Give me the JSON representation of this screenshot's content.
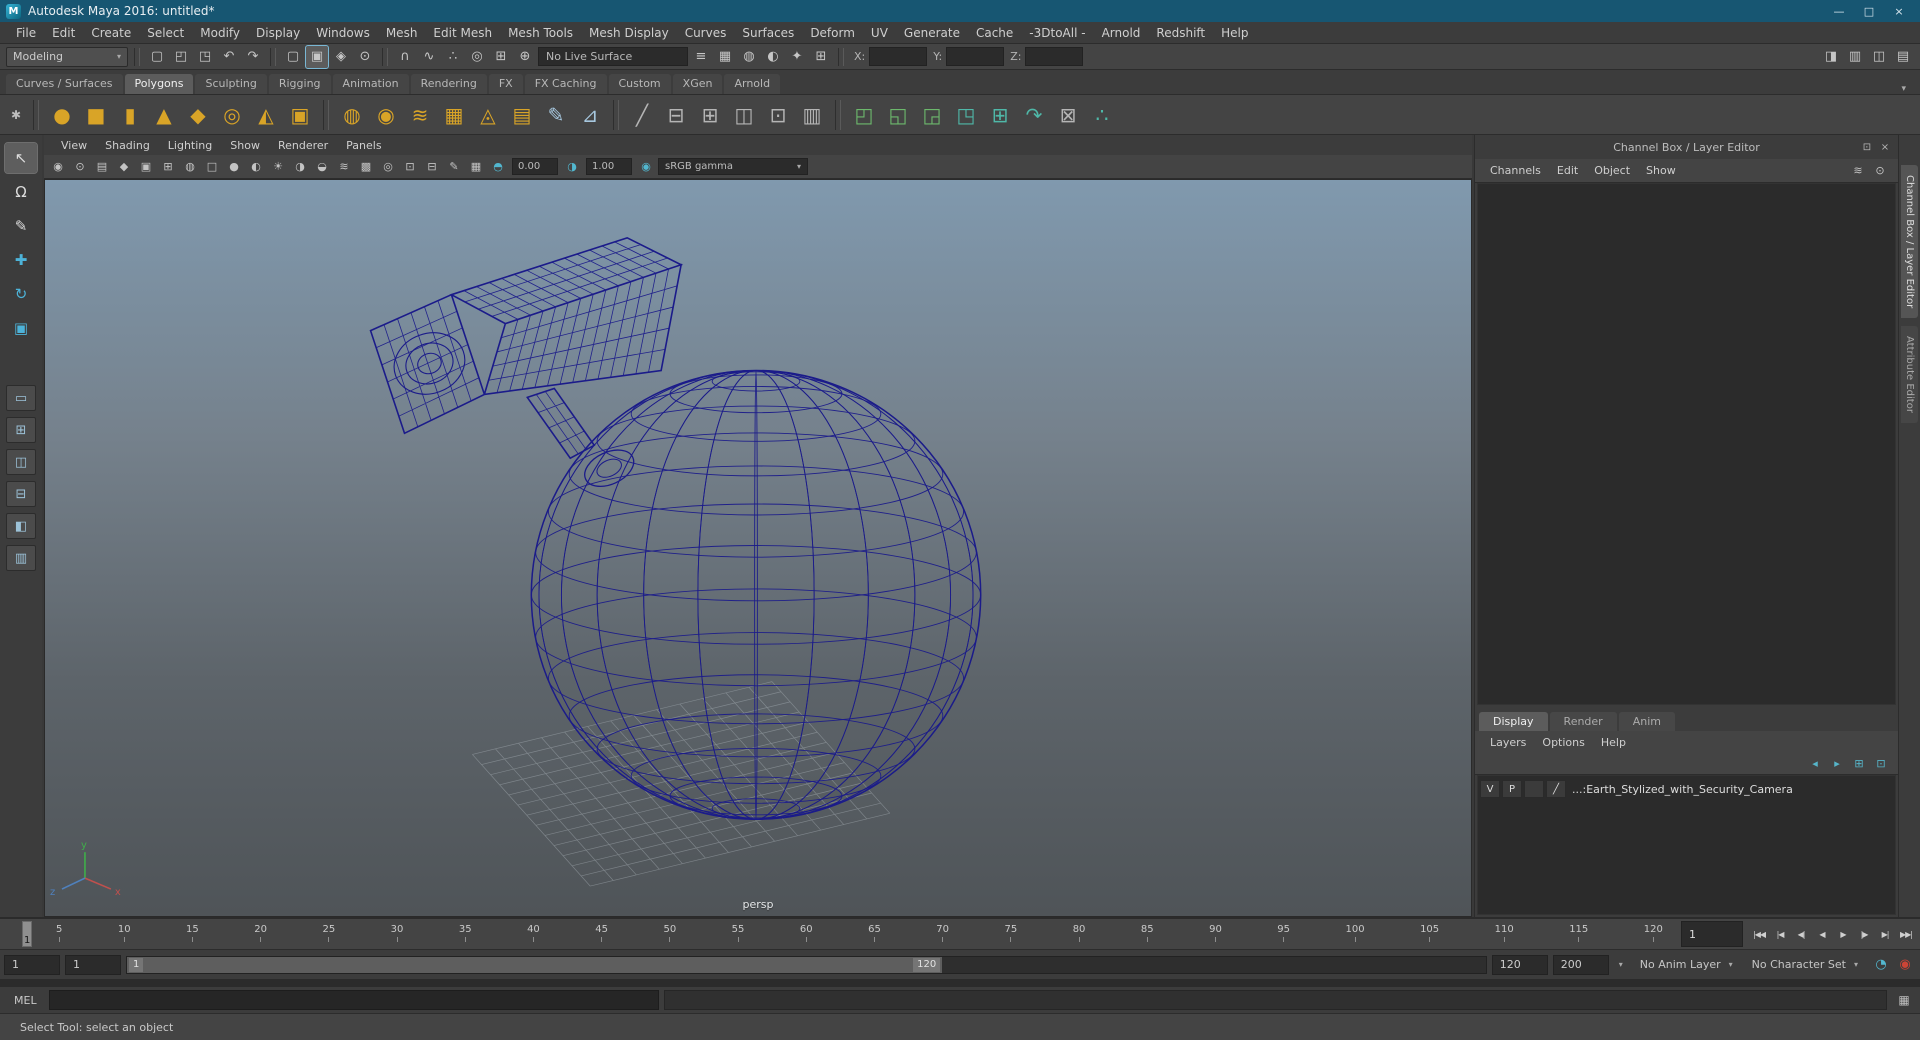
{
  "titlebar": {
    "logo": "M",
    "title": "Autodesk Maya 2016: untitled*",
    "minimize": "—",
    "maximize": "□",
    "close": "×"
  },
  "menubar": {
    "items": [
      "File",
      "Edit",
      "Create",
      "Select",
      "Modify",
      "Display",
      "Windows",
      "Mesh",
      "Edit Mesh",
      "Mesh Tools",
      "Mesh Display",
      "Curves",
      "Surfaces",
      "Deform",
      "UV",
      "Generate",
      "Cache",
      "-3DtoAll -",
      "Arnold",
      "Redshift",
      "Help"
    ]
  },
  "statusline": {
    "mode": {
      "label": "Modeling",
      "caret": "▾"
    },
    "file_icons": [
      {
        "n": "new-scene-icon",
        "g": "▢"
      },
      {
        "n": "open-scene-icon",
        "g": "◰"
      },
      {
        "n": "save-scene-icon",
        "g": "◳"
      }
    ],
    "history_icons": [
      {
        "n": "undo-icon",
        "g": "↶"
      },
      {
        "n": "redo-icon",
        "g": "↷"
      }
    ],
    "selection_icons": [
      {
        "n": "select-hierarchy-icon",
        "g": "▢"
      },
      {
        "n": "select-object-icon",
        "g": "▣",
        "active": true
      },
      {
        "n": "select-component-icon",
        "g": "◈"
      },
      {
        "n": "select-mask-icon",
        "g": "⊙"
      }
    ],
    "snap_icons": [
      {
        "n": "snap-to-grid-icon",
        "g": "∩"
      },
      {
        "n": "snap-to-curve-icon",
        "g": "∿"
      },
      {
        "n": "snap-to-point-icon",
        "g": "∴"
      },
      {
        "n": "snap-projected-center-icon",
        "g": "◎"
      },
      {
        "n": "snap-view-plane-icon",
        "g": "⊞"
      },
      {
        "n": "make-live-icon",
        "g": "⊕"
      }
    ],
    "live_surface": "No Live Surface",
    "render_icons": [
      {
        "n": "construction-history-icon",
        "g": "≡"
      },
      {
        "n": "open-render-view-icon",
        "g": "▦"
      },
      {
        "n": "render-current-frame-icon",
        "g": "◍"
      },
      {
        "n": "ipr-render-icon",
        "g": "◐"
      },
      {
        "n": "render-settings-icon",
        "g": "✦"
      },
      {
        "n": "input-mode-icon",
        "g": "⊞"
      }
    ],
    "coords": {
      "x_label": "X:",
      "y_label": "Y:",
      "z_label": "Z:"
    },
    "right_icons": [
      {
        "n": "toggle-modeling-toolkit-icon",
        "g": "◨"
      },
      {
        "n": "toggle-attribute-editor-icon",
        "g": "▥"
      },
      {
        "n": "toggle-tool-settings-icon",
        "g": "◫"
      },
      {
        "n": "toggle-channel-box-icon",
        "g": "▤"
      }
    ]
  },
  "shelf": {
    "options_icon": "✱",
    "menu_caret": "▾",
    "tabs": [
      {
        "label": "Curves / Surfaces"
      },
      {
        "label": "Polygons",
        "active": true
      },
      {
        "label": "Sculpting"
      },
      {
        "label": "Rigging"
      },
      {
        "label": "Animation"
      },
      {
        "label": "Rendering"
      },
      {
        "label": "FX"
      },
      {
        "label": "FX Caching"
      },
      {
        "label": "Custom"
      },
      {
        "label": "XGen"
      },
      {
        "label": "Arnold"
      }
    ],
    "icons_primitives": [
      {
        "n": "poly-sphere-icon",
        "g": "●",
        "c": "gold"
      },
      {
        "n": "poly-cube-icon",
        "g": "■",
        "c": "gold"
      },
      {
        "n": "poly-cylinder-icon",
        "g": "▮",
        "c": "gold"
      },
      {
        "n": "poly-cone-icon",
        "g": "▲",
        "c": "gold"
      },
      {
        "n": "poly-plane-icon",
        "g": "◆",
        "c": "gold"
      },
      {
        "n": "poly-torus-icon",
        "g": "◎",
        "c": "gold"
      },
      {
        "n": "poly-prism-icon",
        "g": "◭",
        "c": "gold"
      },
      {
        "n": "poly-pipe-icon",
        "g": "▣",
        "c": "gold"
      }
    ],
    "icons_shapes": [
      {
        "n": "smooth-mesh-icon",
        "g": "◍",
        "c": "gold"
      },
      {
        "n": "uv-sphere-icon",
        "g": "◉",
        "c": "gold"
      },
      {
        "n": "poly-disc-icon",
        "g": "≋",
        "c": "gold"
      },
      {
        "n": "poly-grid-icon",
        "g": "▦",
        "c": "gold"
      },
      {
        "n": "platonic-solid-icon",
        "g": "◬",
        "c": "gold"
      },
      {
        "n": "super-shape-icon",
        "g": "▤",
        "c": "gold"
      },
      {
        "n": "pencil-curve-icon",
        "g": "✎",
        "c": "blue"
      },
      {
        "n": "quad-draw-icon",
        "g": "⊿",
        "c": "blue"
      }
    ],
    "icons_edit": [
      {
        "n": "multi-cut-icon",
        "g": "╱",
        "c": "gray"
      },
      {
        "n": "insert-edge-loop-icon",
        "g": "⊟",
        "c": "gray"
      },
      {
        "n": "offset-edge-loop-icon",
        "g": "⊞",
        "c": "gray"
      },
      {
        "n": "crease-tool-icon",
        "g": "◫",
        "c": "gray"
      },
      {
        "n": "target-weld-icon",
        "g": "⊡",
        "c": "gray"
      },
      {
        "n": "connect-tool-icon",
        "g": "▥",
        "c": "gray"
      }
    ],
    "icons_boolean": [
      {
        "n": "combine-icon",
        "g": "◰",
        "c": "green"
      },
      {
        "n": "separate-icon",
        "g": "◱",
        "c": "green"
      },
      {
        "n": "boolean-union-icon",
        "g": "◲",
        "c": "green"
      },
      {
        "n": "extract-icon",
        "g": "◳",
        "c": "teal"
      },
      {
        "n": "duplicate-face-icon",
        "g": "⊞",
        "c": "teal"
      },
      {
        "n": "mirror-geometry-icon",
        "g": "↷",
        "c": "teal"
      },
      {
        "n": "uv-checker-icon",
        "g": "⊠",
        "c": "gray"
      },
      {
        "n": "transfer-attributes-icon",
        "g": "∴",
        "c": "teal"
      }
    ]
  },
  "toolbox": {
    "tools": [
      {
        "n": "select-tool-icon",
        "g": "↖",
        "active": true
      },
      {
        "n": "lasso-tool-icon",
        "g": "Ω"
      },
      {
        "n": "paint-select-tool-icon",
        "g": "✎"
      },
      {
        "n": "move-tool-icon",
        "g": "✚",
        "c": "teal"
      },
      {
        "n": "rotate-tool-icon",
        "g": "↻",
        "c": "teal"
      },
      {
        "n": "scale-tool-icon",
        "g": "▣",
        "c": "teal"
      }
    ],
    "layouts": [
      {
        "n": "layout-single-pane-icon",
        "g": "▭"
      },
      {
        "n": "layout-four-pane-icon",
        "g": "⊞"
      },
      {
        "n": "layout-two-side-by-side-icon",
        "g": "◫"
      },
      {
        "n": "layout-two-stacked-icon",
        "g": "⊟"
      },
      {
        "n": "layout-three-split-icon",
        "g": "◧"
      },
      {
        "n": "layout-outliner-persp-icon",
        "g": "▥"
      }
    ]
  },
  "viewport": {
    "menus": [
      "View",
      "Shading",
      "Lighting",
      "Show",
      "Renderer",
      "Panels"
    ],
    "toolbar_icons": [
      {
        "n": "select-camera-icon",
        "g": "◉"
      },
      {
        "n": "lock-camera-icon",
        "g": "⊙"
      },
      {
        "n": "camera-attributes-icon",
        "g": "▤"
      },
      {
        "n": "bookmarks-icon",
        "g": "◆"
      },
      {
        "n": "image-plane-icon",
        "g": "▣"
      },
      {
        "n": "pan-zoom-2d-icon",
        "g": "⊞"
      },
      {
        "n": "oversampling-icon",
        "g": "◍"
      },
      {
        "n": "wireframe-mode-icon",
        "g": "□"
      },
      {
        "n": "shaded-mode-icon",
        "g": "●"
      },
      {
        "n": "textured-mode-icon",
        "g": "◐"
      },
      {
        "n": "use-all-lights-icon",
        "g": "☀"
      },
      {
        "n": "shadows-icon",
        "g": "◑"
      },
      {
        "n": "ambient-occlusion-icon",
        "g": "◒"
      },
      {
        "n": "motion-blur-icon",
        "g": "≋"
      },
      {
        "n": "multisample-icon",
        "g": "▩"
      },
      {
        "n": "xray-icon",
        "g": "◎"
      },
      {
        "n": "isolate-select-icon",
        "g": "⊡"
      },
      {
        "n": "field-chart-icon",
        "g": "⊟"
      },
      {
        "n": "grease-pencil-icon",
        "g": "✎"
      },
      {
        "n": "grid-toggle-icon",
        "g": "▦"
      }
    ],
    "exposure_icon": {
      "n": "exposure-icon",
      "g": "◓"
    },
    "exposure": "0.00",
    "contrast_icon": {
      "n": "contrast-icon",
      "g": "◑"
    },
    "gamma": "1.00",
    "colorspace_icon": {
      "n": "color-management-icon",
      "g": "◉"
    },
    "colorspace": "sRGB gamma",
    "caret": "▾",
    "camera_label": "persp",
    "axis": {
      "x": "x",
      "y": "y",
      "z": "z"
    }
  },
  "channelbox": {
    "header": "Channel Box / Layer Editor",
    "header_icons": [
      {
        "n": "panel-dock-icon",
        "g": "⊡"
      },
      {
        "n": "panel-close-icon",
        "g": "×"
      }
    ],
    "menus": [
      "Channels",
      "Edit",
      "Object",
      "Show"
    ],
    "menu_icons": [
      {
        "n": "channel-slider-mode-icon",
        "g": "≋"
      },
      {
        "n": "channel-manipulator-icon",
        "g": "⊙"
      }
    ],
    "layer_tabs": [
      {
        "label": "Display",
        "active": true
      },
      {
        "label": "Render"
      },
      {
        "label": "Anim"
      }
    ],
    "layer_menus": [
      "Layers",
      "Options",
      "Help"
    ],
    "layer_toolbar_icons": [
      {
        "n": "layer-move-up-icon",
        "g": "◂"
      },
      {
        "n": "layer-move-down-icon",
        "g": "▸"
      },
      {
        "n": "add-empty-layer-icon",
        "g": "⊞"
      },
      {
        "n": "add-layer-from-selection-icon",
        "g": "⊡"
      }
    ],
    "layers": [
      {
        "visible": "V",
        "playback": "P",
        "swatch": "╱",
        "name": "...:Earth_Stylized_with_Security_Camera"
      }
    ],
    "side_tabs": [
      {
        "label": "Channel Box / Layer Editor",
        "active": true
      },
      {
        "label": "Attribute Editor"
      }
    ]
  },
  "timeline": {
    "current_frame": "1",
    "ticks": [
      "5",
      "10",
      "15",
      "20",
      "25",
      "30",
      "35",
      "40",
      "45",
      "50",
      "55",
      "60",
      "65",
      "70",
      "75",
      "80",
      "85",
      "90",
      "95",
      "100",
      "105",
      "110",
      "115",
      "120"
    ],
    "frame_field": "1",
    "playback_buttons": [
      {
        "n": "go-to-start-button",
        "g": "|◀◀"
      },
      {
        "n": "step-back-frame-button",
        "g": "|◀"
      },
      {
        "n": "step-back-key-button",
        "g": "◀|"
      },
      {
        "n": "play-backwards-button",
        "g": "◀"
      },
      {
        "n": "play-forwards-button",
        "g": "▶"
      },
      {
        "n": "step-forward-key-button",
        "g": "|▶"
      },
      {
        "n": "step-forward-frame-button",
        "g": "▶|"
      },
      {
        "n": "go-to-end-button",
        "g": "▶▶|"
      }
    ]
  },
  "rangebar": {
    "anim_start": "1",
    "play_start": "1",
    "range_start_handle": "1",
    "range_end_handle": "120",
    "play_end": "120",
    "anim_end": "200",
    "caret": "▾",
    "anim_layer": "No Anim Layer",
    "character_set": "No Character Set",
    "icons": [
      {
        "n": "playback-options-icon",
        "g": "◔",
        "c": "teal"
      },
      {
        "n": "auto-key-icon",
        "g": "◉",
        "c": "red"
      }
    ]
  },
  "commandline": {
    "label": "MEL",
    "input_value": "",
    "right_icon": {
      "n": "script-editor-icon",
      "g": "▦"
    }
  },
  "helpline": {
    "text": "Select Tool: select an object"
  }
}
